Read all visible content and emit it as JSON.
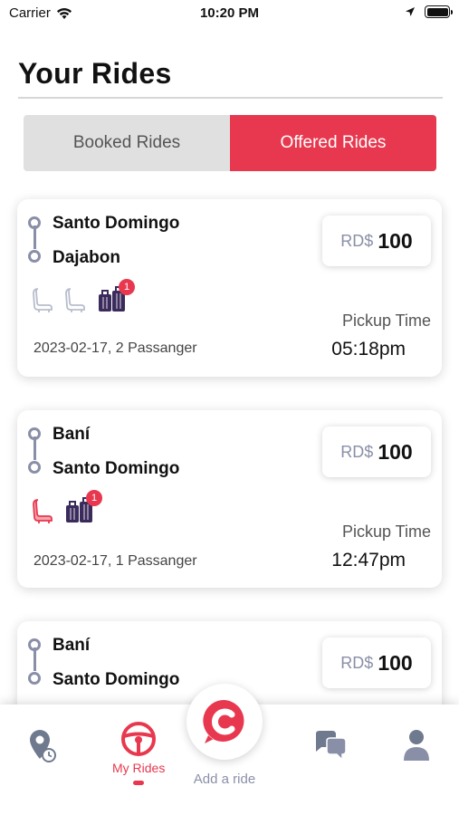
{
  "status_bar": {
    "carrier": "Carrier",
    "time": "10:20 PM"
  },
  "header": {
    "title": "Your Rides"
  },
  "tabs": [
    {
      "label": "Booked Rides",
      "active": false
    },
    {
      "label": "Offered Rides",
      "active": true
    }
  ],
  "rides": [
    {
      "from": "Santo Domingo",
      "to": "Dajabon",
      "currency": "RD$",
      "price": "100",
      "pickup_label": "Pickup Time",
      "pickup_time": "05:18pm",
      "date_pax": "2023-02-17, 2 Passanger",
      "seats": [
        "empty",
        "empty"
      ],
      "luggage_count": "1"
    },
    {
      "from": "Baní",
      "to": "Santo Domingo",
      "currency": "RD$",
      "price": "100",
      "pickup_label": "Pickup Time",
      "pickup_time": "12:47pm",
      "date_pax": "2023-02-17, 1 Passanger",
      "seats": [
        "taken"
      ],
      "luggage_count": "1"
    },
    {
      "from": "Baní",
      "to": "Santo Domingo",
      "currency": "RD$",
      "price": "100"
    }
  ],
  "bottom_nav": {
    "items": [
      {
        "icon": "location-history-icon",
        "label": ""
      },
      {
        "icon": "steering-wheel-icon",
        "label": "My Rides",
        "active": true
      },
      {
        "icon": "chat-icon",
        "label": ""
      },
      {
        "icon": "profile-icon",
        "label": ""
      }
    ],
    "add_ride_label": "Add a ride"
  },
  "colors": {
    "accent": "#e8384f",
    "muted": "#8a8fa8",
    "luggage": "#3b2b5c"
  }
}
